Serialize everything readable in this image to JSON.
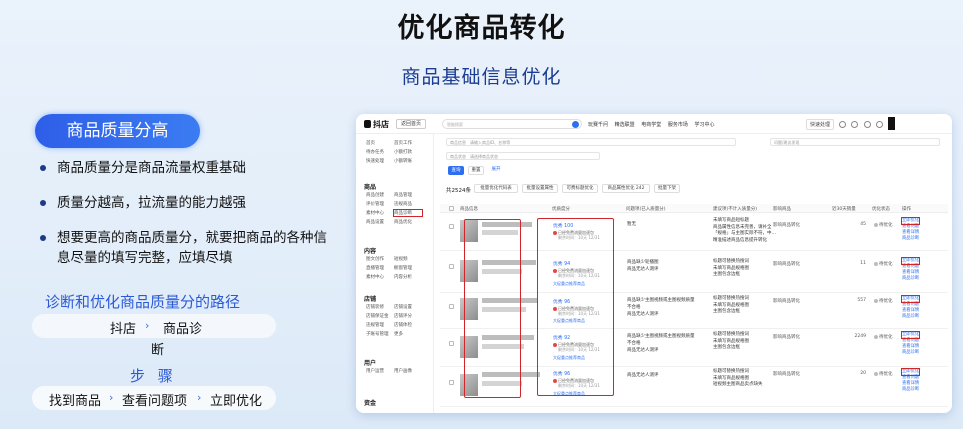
{
  "slide": {
    "title": "优化商品转化",
    "subtitle": "商品基础信息优化",
    "pill": "商品质量分高",
    "bullets": [
      "商品质量分是商品流量权重基础",
      "质量分越高，拉流量的能力越强",
      "想要更高的商品质量分，就要把商品的各种信息尽量的填写完整，应填尽填"
    ],
    "path_title": "诊断和优化商品质量分的路径",
    "path_left": "抖店",
    "path_right": "商品诊",
    "path_wrap": "断",
    "steps_title": "步 骤",
    "steps": [
      "找到商品",
      "查看问题项",
      "立即优化"
    ]
  },
  "app": {
    "logo": "抖店",
    "back": "返回首页",
    "search_placeholder": "智能搜索",
    "topnav": [
      "玩赛千问",
      "精选联盟",
      "电商学堂",
      "服务市场",
      "学习中心"
    ],
    "topright_btn": "快速处理",
    "sidebar": {
      "top_grid": [
        "首页",
        "首页工作",
        "待办任务",
        "小额打款",
        "快速处理",
        "小额转账",
        "快速处理",
        "商品分析"
      ],
      "sections": [
        {
          "title": "商品",
          "items": [
            "商品创建",
            "商品管理",
            "评价管理",
            "违规商品",
            "素材中心",
            "商品诊断",
            "商品设置",
            "商品优化",
            "商品素材"
          ]
        },
        {
          "title": "内容",
          "items": [
            "图文创作",
            "短视频",
            "直播管理",
            "橱窗管理",
            "素材中心",
            "内容分析"
          ]
        },
        {
          "title": "店铺",
          "items": [
            "店铺装修",
            "店铺设置",
            "店铺保证金",
            "店铺评分",
            "违规管理",
            "店铺体检",
            "子账号管理",
            "更多"
          ]
        },
        {
          "title": "用户",
          "items": [
            "用户运营",
            "用户画像"
          ]
        },
        {
          "title": "资金"
        }
      ]
    },
    "filters": {
      "input1": "商品信息",
      "input1_ph": "请输入商品ID、名称等",
      "input2": "问题/建议发现",
      "input3": "商品状态",
      "input3_ph": "请选择商品状态",
      "query": "查询",
      "reset": "重置",
      "more": "展开"
    },
    "total": "共2524条",
    "batch_buttons": [
      "批量优化代码表",
      "批量设置属性",
      "可费标题优化",
      "商品属性优化 242",
      "批量下架"
    ],
    "columns": [
      "商品信息",
      "优质度分",
      "问题项(已入质量分)",
      "建议项(不计入质量分)",
      "影响商品",
      "近30天销量",
      "优化状态",
      "操作"
    ],
    "rows": [
      {
        "score": "优秀 100",
        "warn": "已经免费流量加速包",
        "warn2": "剩余时间：10天 12/31",
        "rec": "",
        "problems": [
          "暂无"
        ],
        "suggestions": [
          "未填写商品短标题",
          "商品属性信息未完善，请补全",
          "「规格」与主图实际不符，中…",
          "精准描述商品信息提升转化"
        ],
        "impact": "影响商品转化",
        "sales": "45",
        "status": "待优化",
        "ops": [
          "立即优化",
          "查看问题",
          "查看详情",
          "商品诊断"
        ]
      },
      {
        "score": "优秀 94",
        "warn": "已经免费流量加速包",
        "warn2": "剩余时间：10天 12/31",
        "rec": "大促重点推荐商品",
        "problems": [
          "商品缺少轮播图",
          "商品无达人测评"
        ],
        "suggestions": [
          "标题可替换热搜词",
          "未填写商品规格图",
          "主图包含边框"
        ],
        "impact": "影响商品转化",
        "sales": "11",
        "status": "待优化",
        "ops": [
          "立即优化",
          "查看问题",
          "查看详情",
          "商品诊断"
        ]
      },
      {
        "score": "优秀 96",
        "warn": "已经免费流量加速包",
        "warn2": "剩余时间：10天 12/31",
        "rec": "大促重点推荐商品",
        "problems": [
          "商品缺少主图视频或主图视频质量不合格",
          "商品无达人测评"
        ],
        "suggestions": [
          "标题可替换热搜词",
          "未填写商品规格图",
          "主图包含边框"
        ],
        "impact": "影响商品转化",
        "sales": "557",
        "status": "待优化",
        "ops": [
          "立即优化",
          "查看问题",
          "查看详情",
          "商品诊断"
        ]
      },
      {
        "score": "优秀 92",
        "warn": "已经免费流量加速包",
        "warn2": "剩余时间：10天 12/31",
        "rec": "大促重点推荐商品",
        "problems": [
          "商品缺少主图视频或主图视频质量不合格",
          "商品无达人测评"
        ],
        "suggestions": [
          "标题可替换热搜词",
          "未填写商品规格图",
          "主图包含边框"
        ],
        "impact": "影响商品转化",
        "sales": "2249",
        "status": "待优化",
        "ops": [
          "立即优化",
          "查看问题",
          "查看详情",
          "商品诊断"
        ]
      },
      {
        "score": "优秀 96",
        "warn": "已经免费流量加速包",
        "warn2": "剩余时间：10天 12/31",
        "rec": "大促重点推荐商品",
        "problems": [
          "商品无达人测评"
        ],
        "suggestions": [
          "标题可替换热搜词",
          "未填写商品规格图",
          "短视频主图商品卖点缺失"
        ],
        "impact": "影响商品转化",
        "sales": "20",
        "status": "待优化",
        "ops": [
          "立即优化",
          "查看问题",
          "查看详情",
          "商品诊断"
        ]
      }
    ]
  },
  "colors": {
    "accent": "#2e6ef2",
    "highlight": "#d0262a",
    "title_blue": "#1a3c92"
  }
}
